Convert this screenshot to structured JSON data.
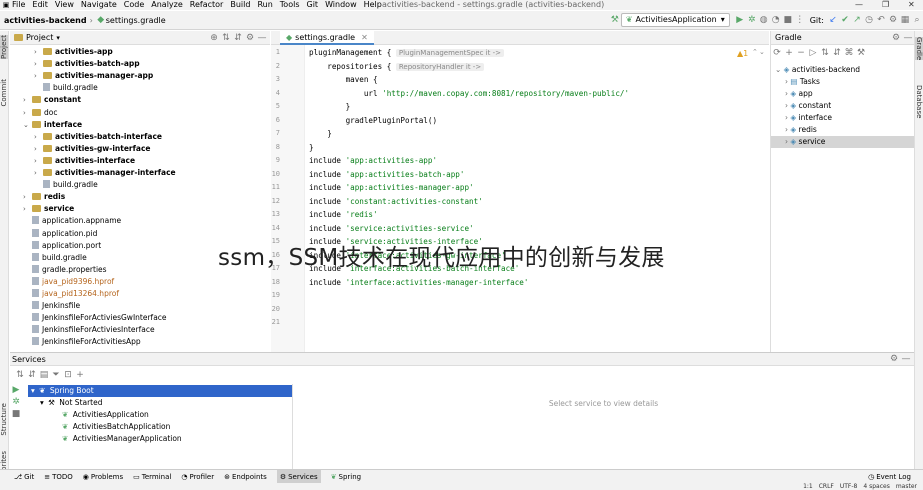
{
  "menubar": {
    "items": [
      "File",
      "Edit",
      "View",
      "Navigate",
      "Code",
      "Analyze",
      "Refactor",
      "Build",
      "Run",
      "Tools",
      "Git",
      "Window",
      "Help"
    ],
    "window_title": "activities-backend - settings.gradle (activities-backend)"
  },
  "navbar": {
    "project": "activities-backend",
    "file": "settings.gradle",
    "run_config": "ActivitiesApplication",
    "git_label": "Git:"
  },
  "project_panel": {
    "title": "Project",
    "items": [
      {
        "label": "activities-app",
        "bold": true
      },
      {
        "label": "activities-batch-app",
        "bold": true
      },
      {
        "label": "activities-manager-app",
        "bold": true
      },
      {
        "label": "build.gradle",
        "bold": false
      },
      {
        "label": "constant",
        "bold": true
      },
      {
        "label": "doc",
        "bold": false
      },
      {
        "label": "interface",
        "bold": true
      },
      {
        "label": "activities-batch-interface",
        "bold": true
      },
      {
        "label": "activities-gw-interface",
        "bold": true
      },
      {
        "label": "activities-interface",
        "bold": true
      },
      {
        "label": "activities-manager-interface",
        "bold": true
      },
      {
        "label": "build.gradle",
        "bold": false
      },
      {
        "label": "redis",
        "bold": true
      },
      {
        "label": "service",
        "bold": true
      },
      {
        "label": "application.appname",
        "bold": false
      },
      {
        "label": "application.pid",
        "bold": false
      },
      {
        "label": "application.port",
        "bold": false
      },
      {
        "label": "build.gradle",
        "bold": false
      },
      {
        "label": "gradle.properties",
        "bold": false
      },
      {
        "label": "java_pid9396.hprof",
        "bold": false
      },
      {
        "label": "java_pid13264.hprof",
        "bold": false
      },
      {
        "label": "Jenkinsfile",
        "bold": false
      },
      {
        "label": "JenkinsfileForActiviesGwInterface",
        "bold": false
      },
      {
        "label": "JenkinsfileForActiviesInterface",
        "bold": false
      },
      {
        "label": "JenkinsfileForActivitiesApp",
        "bold": false
      }
    ]
  },
  "editor": {
    "tab": "settings.gradle",
    "line_numbers": [
      "1",
      "2",
      "3",
      "4",
      "5",
      "6",
      "7",
      "8",
      "9",
      "10",
      "11",
      "12",
      "13",
      "14",
      "15",
      "16",
      "17",
      "18",
      "19",
      "20",
      "21"
    ],
    "lines": [
      {
        "code": "pluginManagement {",
        "hint": "PluginManagementSpec it ->"
      },
      {
        "code": "    repositories {",
        "hint": "RepositoryHandler it ->"
      },
      {
        "code": "        maven {",
        "hint": ""
      },
      {
        "code": "            url ",
        "str": "'http://maven.copay.com:8081/repository/maven-public/'",
        "hint": ""
      },
      {
        "code": "        }",
        "hint": ""
      },
      {
        "code": "        gradlePluginPortal()",
        "hint": ""
      },
      {
        "code": "    }",
        "hint": ""
      },
      {
        "code": "}",
        "hint": ""
      },
      {
        "code": "include ",
        "str": "'app:activities-app'",
        "hint": ""
      },
      {
        "code": "include ",
        "str": "'app:activities-batch-app'",
        "hint": ""
      },
      {
        "code": "include ",
        "str": "'app:activities-manager-app'",
        "hint": ""
      },
      {
        "code": "include ",
        "str": "'constant:activities-constant'",
        "hint": ""
      },
      {
        "code": "include ",
        "str": "'redis'",
        "hint": ""
      },
      {
        "code": "include ",
        "str": "'service:activities-service'",
        "hint": ""
      },
      {
        "code": "include ",
        "str": "'service:activities-interface'",
        "hint": ""
      },
      {
        "code": "include ",
        "str": "'interface:activities-gw-interface'",
        "hint": ""
      },
      {
        "code": "include ",
        "str": "'interface:activities-batch-interface'",
        "hint": ""
      },
      {
        "code": "include ",
        "str": "'interface:activities-manager-interface'",
        "hint": ""
      },
      {
        "code": "",
        "hint": ""
      },
      {
        "code": "",
        "hint": ""
      },
      {
        "code": "",
        "hint": ""
      }
    ]
  },
  "gradle_panel": {
    "title": "Gradle",
    "items": [
      "activities-backend",
      "Tasks",
      "app",
      "constant",
      "interface",
      "redis",
      "service"
    ]
  },
  "services": {
    "title": "Services",
    "tree": [
      "Spring Boot",
      "Not Started",
      "ActivitiesApplication",
      "ActivitiesBatchApplication",
      "ActivitiesManagerApplication"
    ],
    "empty_text": "Select service to view details"
  },
  "left_stripe": [
    "Project",
    "Commit",
    "Structure",
    "Favorites"
  ],
  "right_stripe": [
    "Gradle",
    "Database"
  ],
  "bottom_tabs": [
    "Git",
    "TODO",
    "Problems",
    "Terminal",
    "Profiler",
    "Endpoints",
    "Services",
    "Spring"
  ],
  "event_log": "Event Log",
  "status": {
    "position": "1:1",
    "line_sep": "CRLF",
    "encoding": "UTF-8",
    "indent": "4 spaces",
    "branch": "master"
  },
  "watermark": "ssm，SSM技术在现代应用中的创新与发展",
  "colors": {
    "accent": "#2f65ca",
    "string": "#067d17",
    "folder": "#c9a94a"
  }
}
